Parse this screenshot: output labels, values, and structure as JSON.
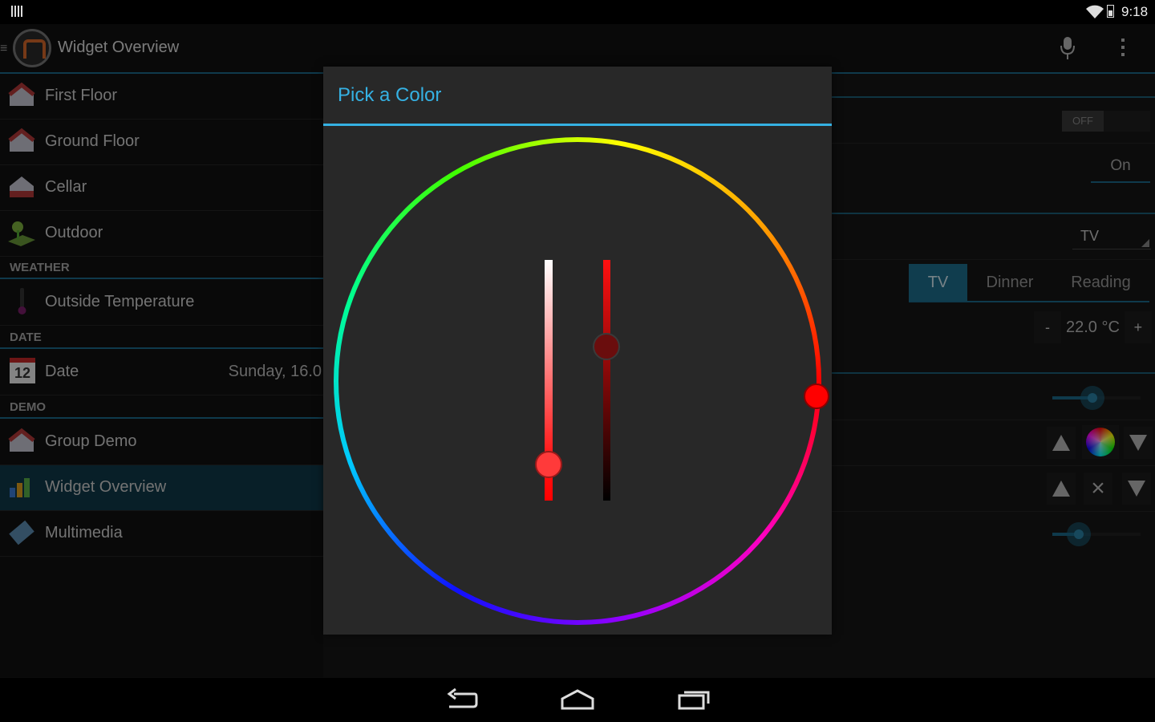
{
  "status_bar": {
    "time": "9:18"
  },
  "action_bar": {
    "title": "Widget Overview"
  },
  "drawer": {
    "items_top": [
      {
        "label": "First Floor",
        "icon": "house-icon"
      },
      {
        "label": "Ground Floor",
        "icon": "house-icon"
      },
      {
        "label": "Cellar",
        "icon": "house-icon"
      },
      {
        "label": "Outdoor",
        "icon": "garden-icon"
      }
    ],
    "sections": [
      {
        "header": "WEATHER",
        "items": [
          {
            "label": "Outside Temperature",
            "icon": "thermometer-icon"
          }
        ]
      },
      {
        "header": "DATE",
        "items": [
          {
            "label": "Date",
            "value": "Sunday, 16.0",
            "icon": "calendar-icon",
            "icon_text": "12"
          }
        ]
      },
      {
        "header": "DEMO",
        "items": [
          {
            "label": "Group Demo",
            "icon": "house-icon"
          },
          {
            "label": "Widget Overview",
            "icon": "bar-chart-icon",
            "active": true
          },
          {
            "label": "Multimedia",
            "icon": "film-icon"
          }
        ]
      }
    ]
  },
  "right_pane": {
    "switch_label": "OFF",
    "on_button": "On",
    "selection_value": "TV",
    "segments": [
      "TV",
      "Dinner",
      "Reading"
    ],
    "setpoint": {
      "minus": "-",
      "value": "22.0 °C",
      "plus": "+"
    },
    "slider1_level": 0.45,
    "slider2_level": 0.3,
    "colorpicker_row": {
      "up": "up-icon",
      "color": "color-wheel-icon",
      "down": "down-icon"
    },
    "rollershutter_row": {
      "up": "up-icon",
      "stop": "×",
      "down": "down-icon"
    }
  },
  "dialog": {
    "title": "Pick a Color",
    "hue_color": "#ff0000",
    "saturation_level": 0.85,
    "value_level": 0.64,
    "accent": "#35b1e3"
  },
  "colors": {
    "accent_blue": "#35b1e3",
    "divider_blue": "#1c6b8a"
  },
  "nav_bar": {
    "back": "back-icon",
    "home": "home-icon",
    "recents": "recents-icon"
  }
}
